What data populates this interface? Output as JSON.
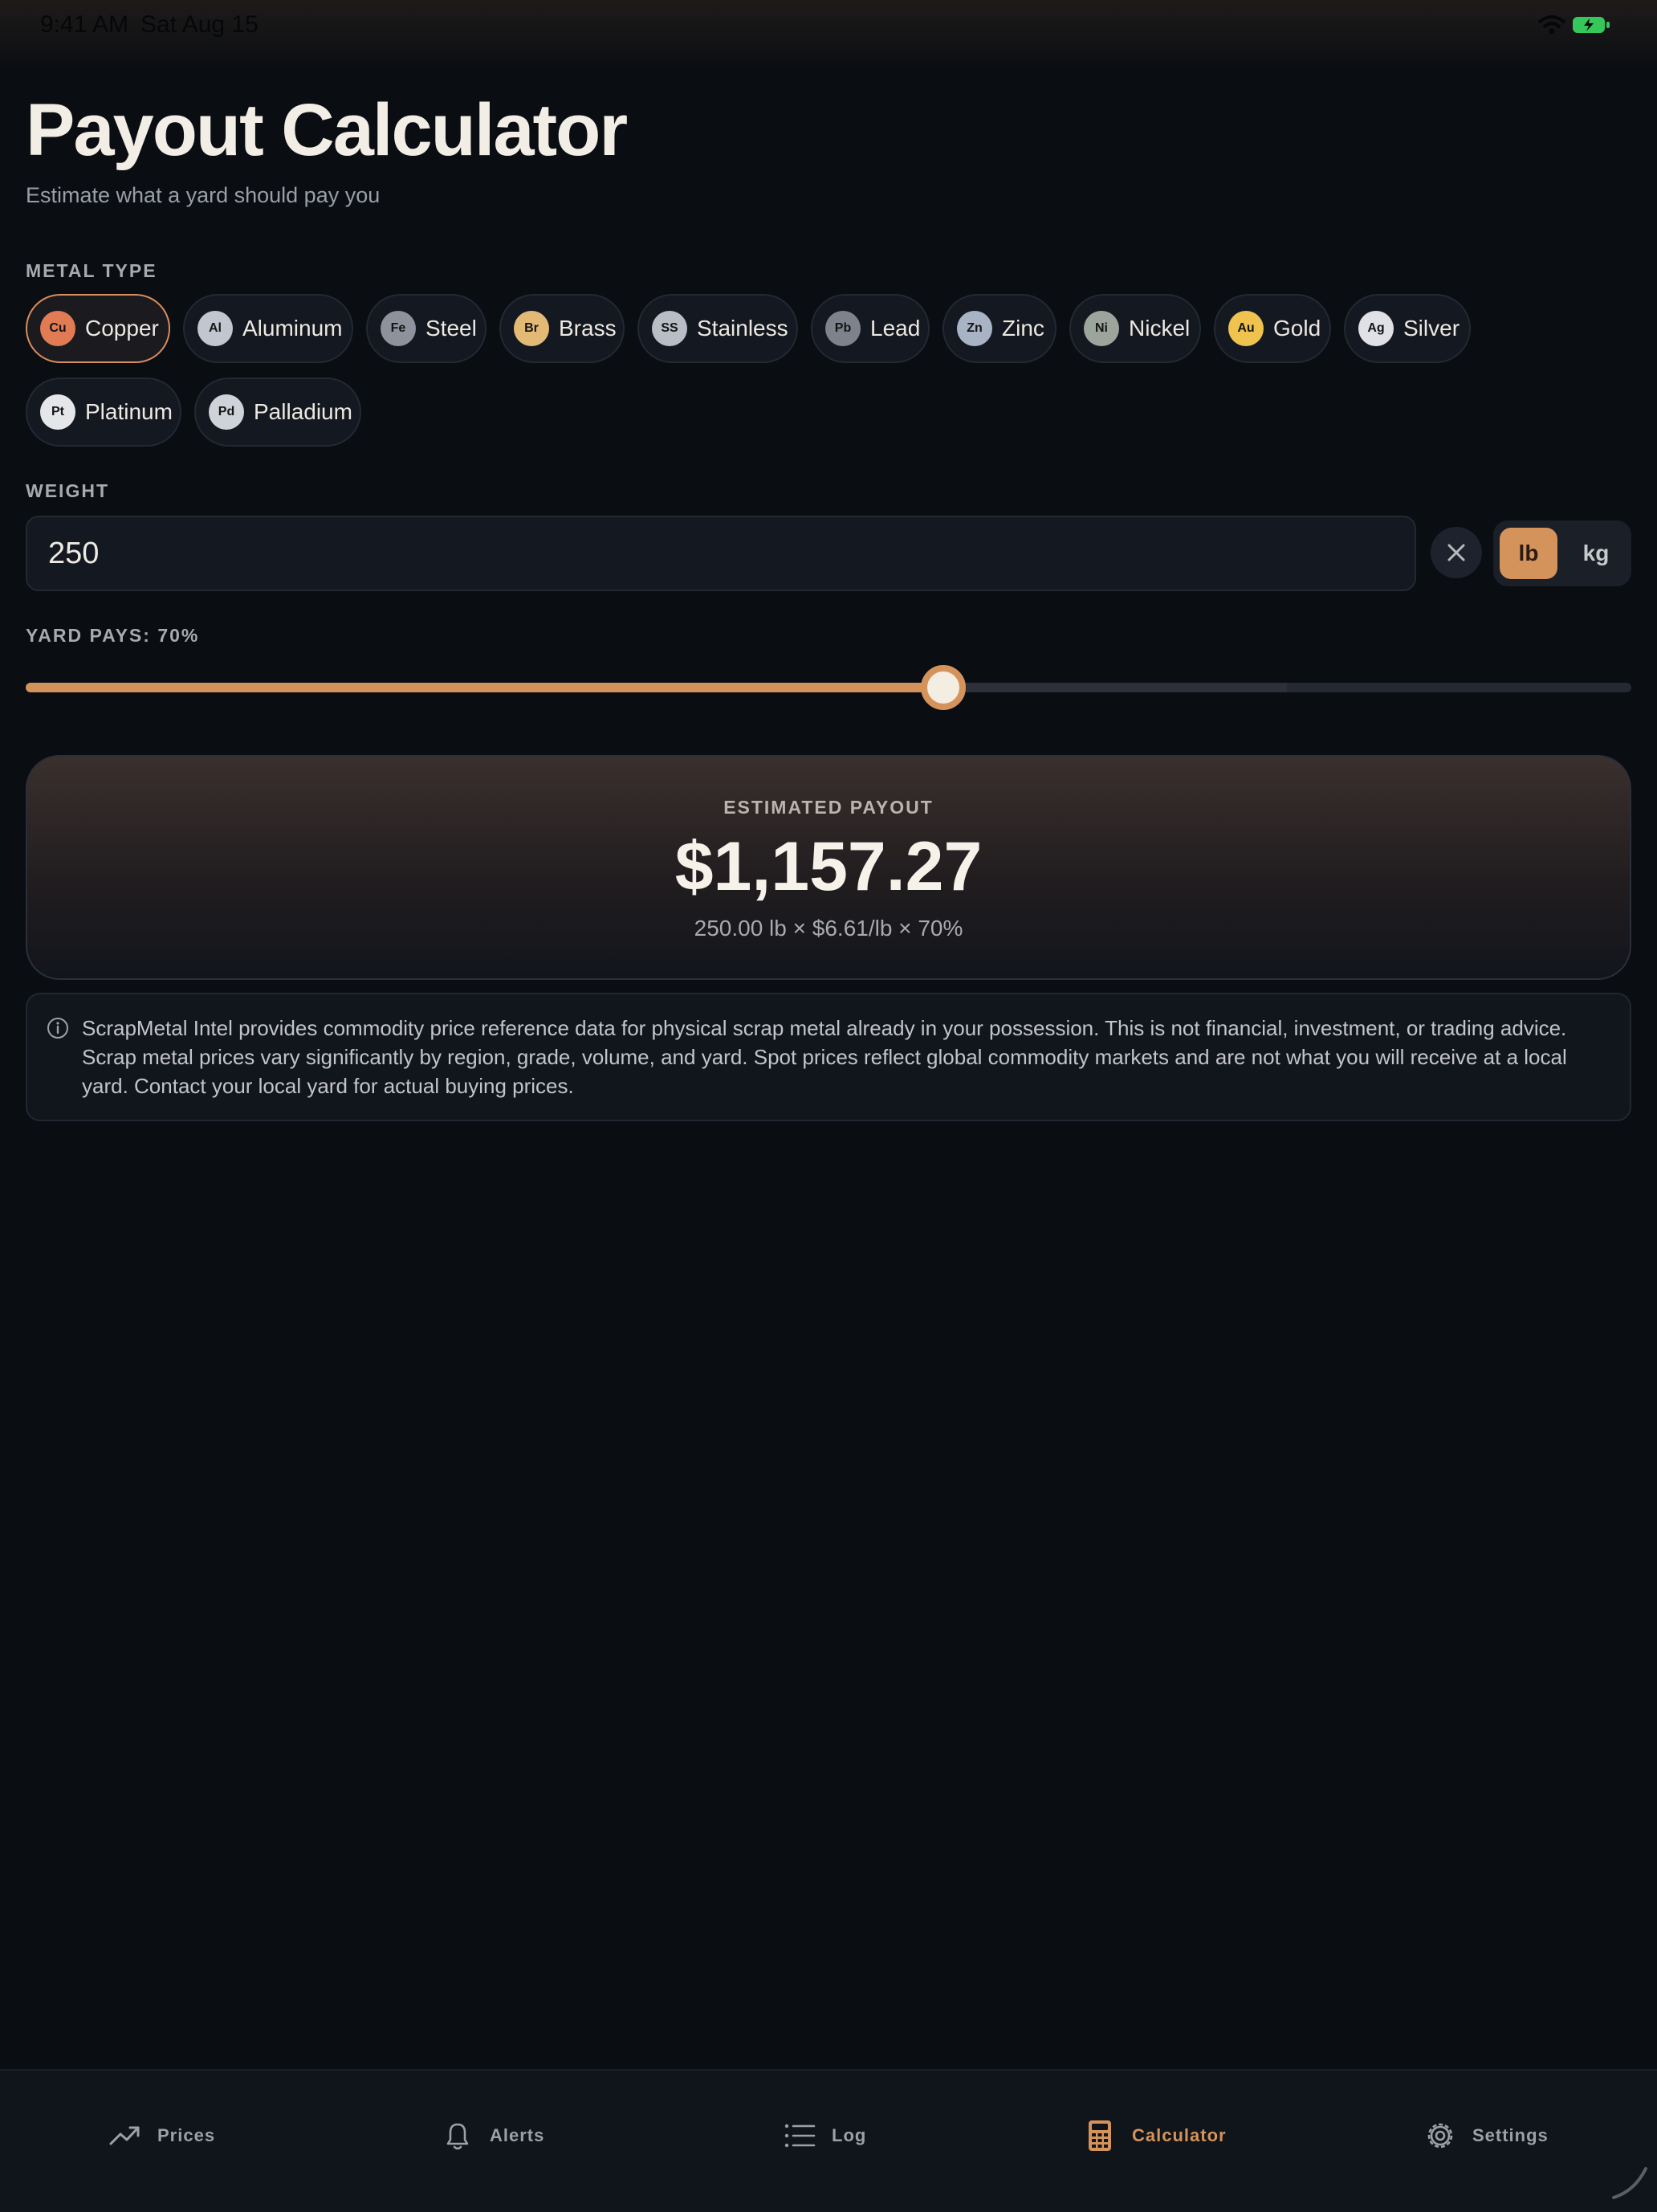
{
  "status_bar": {
    "time": "9:41 AM",
    "date": "Sat Aug 15"
  },
  "header": {
    "title": "Payout Calculator",
    "subtitle": "Estimate what a yard should pay you"
  },
  "metal_type": {
    "label": "METAL TYPE",
    "selected": "Copper",
    "metals": [
      {
        "symbol": "Cu",
        "name": "Copper",
        "color": "#e07b54"
      },
      {
        "symbol": "Al",
        "name": "Aluminum",
        "color": "#c2c6cf"
      },
      {
        "symbol": "Fe",
        "name": "Steel",
        "color": "#8c939c"
      },
      {
        "symbol": "Br",
        "name": "Brass",
        "color": "#e3b976"
      },
      {
        "symbol": "SS",
        "name": "Stainless",
        "color": "#b9bdc6"
      },
      {
        "symbol": "Pb",
        "name": "Lead",
        "color": "#7d838c"
      },
      {
        "symbol": "Zn",
        "name": "Zinc",
        "color": "#a9b3c6"
      },
      {
        "symbol": "Ni",
        "name": "Nickel",
        "color": "#9ba59c"
      },
      {
        "symbol": "Au",
        "name": "Gold",
        "color": "#f0c24e"
      },
      {
        "symbol": "Ag",
        "name": "Silver",
        "color": "#dfe1e6"
      },
      {
        "symbol": "Pt",
        "name": "Platinum",
        "color": "#e4e6ea"
      },
      {
        "symbol": "Pd",
        "name": "Palladium",
        "color": "#cfd2d8"
      }
    ]
  },
  "weight": {
    "label": "WEIGHT",
    "value": "250",
    "units": [
      "lb",
      "kg"
    ],
    "selected_unit": "lb"
  },
  "yard_pays": {
    "label": "YARD PAYS: 70%",
    "value_fraction": 0.5714
  },
  "payout": {
    "label": "ESTIMATED PAYOUT",
    "amount": "$1,157.27",
    "formula": "250.00 lb × $6.61/lb × 70%"
  },
  "disclaimer": {
    "icon": "info-icon",
    "text": "ScrapMetal Intel provides commodity price reference data for physical scrap metal already in your possession. This is not financial, investment, or trading advice. Scrap metal prices vary significantly by region, grade, volume, and yard. Spot prices reflect global commodity markets and are not what you will receive at a local yard. Contact your local yard for actual buying prices."
  },
  "tabs": [
    {
      "label": "Prices",
      "icon": "trend-icon"
    },
    {
      "label": "Alerts",
      "icon": "bell-icon"
    },
    {
      "label": "Log",
      "icon": "list-icon"
    },
    {
      "label": "Calculator",
      "icon": "calculator-icon",
      "active": true
    },
    {
      "label": "Settings",
      "icon": "gear-icon"
    }
  ],
  "colors": {
    "accent": "#d4935a",
    "background": "#0a0d12",
    "card": "#141820"
  }
}
